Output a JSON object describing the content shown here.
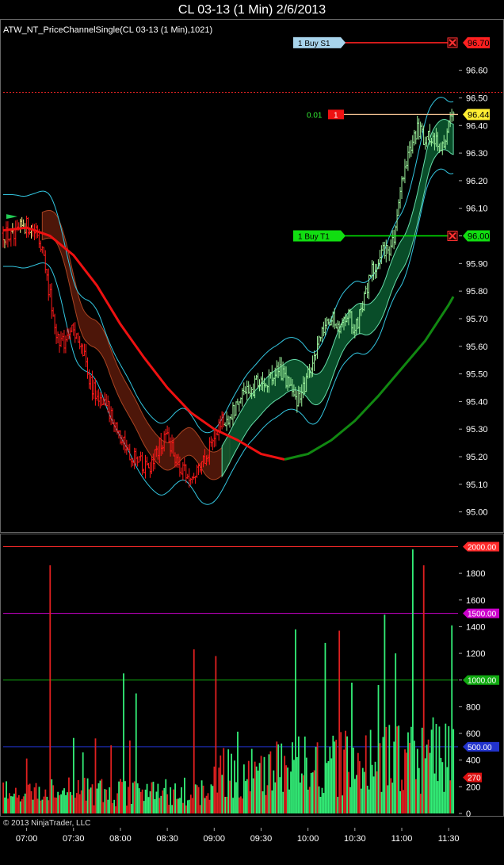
{
  "header": {
    "title": "CL 03-13 (1 Min)  2/6/2013",
    "indicator_label": "ATW_NT_PriceChannelSingle(CL 03-13 (1 Min),1021)",
    "copyright": "© 2013 NinjaTrader, LLC"
  },
  "chart_data": [
    {
      "type": "candlestick",
      "ylim": [
        94.93,
        96.78
      ],
      "yticks": [
        "95.00",
        "95.10",
        "95.20",
        "95.30",
        "95.40",
        "95.50",
        "95.60",
        "95.70",
        "95.80",
        "95.90",
        "96.00",
        "96.10",
        "96.20",
        "96.30",
        "96.40",
        "96.50",
        "96.60"
      ],
      "xticks": [
        "07:00",
        "07:30",
        "08:00",
        "08:30",
        "09:00",
        "09:30",
        "10:00",
        "10:30",
        "11:00",
        "11:30"
      ],
      "xlim_minutes": [
        405,
        696
      ],
      "price_path": [
        {
          "t": 405,
          "p": 96.01
        },
        {
          "t": 412,
          "p": 95.99
        },
        {
          "t": 418,
          "p": 96.04
        },
        {
          "t": 424,
          "p": 96.03
        },
        {
          "t": 430,
          "p": 95.95
        },
        {
          "t": 435,
          "p": 95.78
        },
        {
          "t": 440,
          "p": 95.63
        },
        {
          "t": 445,
          "p": 95.6
        },
        {
          "t": 450,
          "p": 95.67
        },
        {
          "t": 455,
          "p": 95.6
        },
        {
          "t": 460,
          "p": 95.48
        },
        {
          "t": 465,
          "p": 95.42
        },
        {
          "t": 470,
          "p": 95.4
        },
        {
          "t": 475,
          "p": 95.33
        },
        {
          "t": 480,
          "p": 95.27
        },
        {
          "t": 485,
          "p": 95.22
        },
        {
          "t": 490,
          "p": 95.2
        },
        {
          "t": 495,
          "p": 95.17
        },
        {
          "t": 500,
          "p": 95.16
        },
        {
          "t": 505,
          "p": 95.25
        },
        {
          "t": 510,
          "p": 95.27
        },
        {
          "t": 515,
          "p": 95.2
        },
        {
          "t": 520,
          "p": 95.15
        },
        {
          "t": 525,
          "p": 95.12
        },
        {
          "t": 530,
          "p": 95.16
        },
        {
          "t": 535,
          "p": 95.2
        },
        {
          "t": 540,
          "p": 95.26
        },
        {
          "t": 545,
          "p": 95.33
        },
        {
          "t": 550,
          "p": 95.35
        },
        {
          "t": 555,
          "p": 95.4
        },
        {
          "t": 560,
          "p": 95.42
        },
        {
          "t": 565,
          "p": 95.45
        },
        {
          "t": 570,
          "p": 95.48
        },
        {
          "t": 575,
          "p": 95.47
        },
        {
          "t": 580,
          "p": 95.52
        },
        {
          "t": 585,
          "p": 95.49
        },
        {
          "t": 590,
          "p": 95.42
        },
        {
          "t": 595,
          "p": 95.4
        },
        {
          "t": 600,
          "p": 95.5
        },
        {
          "t": 605,
          "p": 95.58
        },
        {
          "t": 610,
          "p": 95.65
        },
        {
          "t": 615,
          "p": 95.7
        },
        {
          "t": 620,
          "p": 95.68
        },
        {
          "t": 625,
          "p": 95.72
        },
        {
          "t": 630,
          "p": 95.66
        },
        {
          "t": 635,
          "p": 95.75
        },
        {
          "t": 640,
          "p": 95.86
        },
        {
          "t": 645,
          "p": 95.92
        },
        {
          "t": 650,
          "p": 95.95
        },
        {
          "t": 655,
          "p": 95.98
        },
        {
          "t": 660,
          "p": 96.2
        },
        {
          "t": 665,
          "p": 96.33
        },
        {
          "t": 670,
          "p": 96.38
        },
        {
          "t": 675,
          "p": 96.35
        },
        {
          "t": 680,
          "p": 96.37
        },
        {
          "t": 685,
          "p": 96.3
        },
        {
          "t": 690,
          "p": 96.4
        },
        {
          "t": 693,
          "p": 96.44
        }
      ],
      "red_until_minute": 547,
      "curves": {
        "red": [
          {
            "t": 405,
            "p": 96.02
          },
          {
            "t": 420,
            "p": 96.03
          },
          {
            "t": 435,
            "p": 96.0
          },
          {
            "t": 450,
            "p": 95.93
          },
          {
            "t": 465,
            "p": 95.82
          },
          {
            "t": 480,
            "p": 95.68
          },
          {
            "t": 495,
            "p": 95.56
          },
          {
            "t": 510,
            "p": 95.45
          },
          {
            "t": 525,
            "p": 95.36
          },
          {
            "t": 540,
            "p": 95.3
          },
          {
            "t": 555,
            "p": 95.26
          },
          {
            "t": 570,
            "p": 95.21
          },
          {
            "t": 585,
            "p": 95.19
          }
        ],
        "green": [
          {
            "t": 585,
            "p": 95.19
          },
          {
            "t": 600,
            "p": 95.21
          },
          {
            "t": 615,
            "p": 95.26
          },
          {
            "t": 630,
            "p": 95.33
          },
          {
            "t": 645,
            "p": 95.42
          },
          {
            "t": 660,
            "p": 95.52
          },
          {
            "t": 675,
            "p": 95.62
          },
          {
            "t": 690,
            "p": 95.75
          },
          {
            "t": 693,
            "p": 95.78
          }
        ]
      },
      "levels": [
        {
          "price": 96.7,
          "label": "96.70",
          "order": "1  Buy S1",
          "color": "#ff2020",
          "tag_bg": "#ff2020",
          "order_bg": "#a8d4ec",
          "order_fg": "#000"
        },
        {
          "price": 96.0,
          "label": "96.00",
          "order": "1  Buy T1",
          "color": "#00ee00",
          "tag_bg": "#11dd11",
          "order_bg": "#11dd11",
          "order_fg": "#000"
        }
      ],
      "last_price": {
        "price": 96.44,
        "label": "96.44",
        "qty": "1",
        "pnl": "0.01"
      },
      "dotted_level": 96.52
    },
    {
      "type": "bar",
      "ylim": [
        0,
        2080
      ],
      "yticks": [
        "0",
        "200",
        "400",
        "600",
        "800",
        "1000",
        "1200",
        "1400",
        "1600",
        "1800"
      ],
      "hlines": [
        {
          "value": 2000,
          "label": "2000.00",
          "color": "#ff2a2a"
        },
        {
          "value": 1500,
          "label": "1500.00",
          "color": "#cc00cc"
        },
        {
          "value": 1000,
          "label": "1000.00",
          "color": "#11aa11"
        },
        {
          "value": 500,
          "label": "500.00",
          "color": "#2233cc"
        }
      ],
      "last_value": {
        "value": 270,
        "label": "270"
      },
      "spikes": [
        {
          "t": 435,
          "v": 1860
        },
        {
          "t": 482,
          "v": 1050
        },
        {
          "t": 490,
          "v": 900
        },
        {
          "t": 527,
          "v": 1230
        },
        {
          "t": 541,
          "v": 1180
        },
        {
          "t": 592,
          "v": 1380
        },
        {
          "t": 620,
          "v": 1370
        },
        {
          "t": 649,
          "v": 1490
        },
        {
          "t": 656,
          "v": 1200
        },
        {
          "t": 667,
          "v": 1980
        },
        {
          "t": 674,
          "v": 1860
        },
        {
          "t": 692,
          "v": 1410
        }
      ]
    }
  ]
}
